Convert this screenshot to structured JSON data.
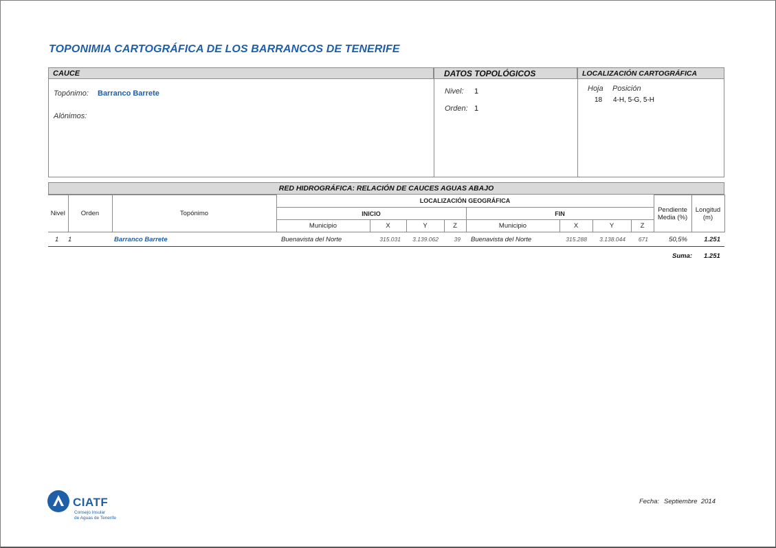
{
  "title": "TOPONIMIA CARTOGRÁFICA DE LOS BARRANCOS DE TENERIFE",
  "cauce": {
    "header": "CAUCE",
    "toponimo_label": "Topónimo:",
    "toponimo_value": "Barranco Barrete",
    "alonimos_label": "Alónimos:"
  },
  "datos_topologicos": {
    "header": "DATOS TOPOLÓGICOS",
    "nivel_label": "Nivel:",
    "nivel_value": "1",
    "orden_label": "Orden:",
    "orden_value": "1"
  },
  "localizacion_cartografica": {
    "header": "LOCALIZACIÓN CARTOGRÁFICA",
    "hoja_label": "Hoja",
    "posicion_label": "Posición",
    "hoja_value": "18",
    "posicion_value": "4-H, 5-G, 5-H"
  },
  "red": {
    "header": "RED HIDROGRÁFICA: RELACIÓN DE CAUCES AGUAS ABAJO",
    "columns": {
      "nivel": "Nivel",
      "orden": "Orden",
      "toponimo": "Topónimo",
      "loc_geo": "LOCALIZACIÓN GEOGRÁFICA",
      "inicio": "INICIO",
      "fin": "FIN",
      "municipio": "Municipio",
      "x": "X",
      "y": "Y",
      "z": "Z",
      "pendiente": "Pendiente Media (%)",
      "longitud": "Longitud (m)"
    },
    "rows": [
      {
        "nivel": "1",
        "orden": "1",
        "toponimo": "Barranco Barrete",
        "inicio_municipio": "Buenavista del Norte",
        "inicio_x": "315.031",
        "inicio_y": "3.139.062",
        "inicio_z": "39",
        "fin_municipio": "Buenavista del Norte",
        "fin_x": "315.288",
        "fin_y": "3.138.044",
        "fin_z": "671",
        "pendiente": "50,5%",
        "longitud": "1.251"
      }
    ],
    "suma_label": "Suma:",
    "suma_value": "1.251"
  },
  "footer": {
    "logo_name": "CIATF",
    "logo_sub_1": "Consejo Insular",
    "logo_sub_2": "de Aguas de Tenerife",
    "fecha_label": "Fecha:",
    "fecha_value": "Septiembre  2014"
  },
  "colors": {
    "accent": "#1f5fa8",
    "header_bg": "#d9d9d9"
  }
}
